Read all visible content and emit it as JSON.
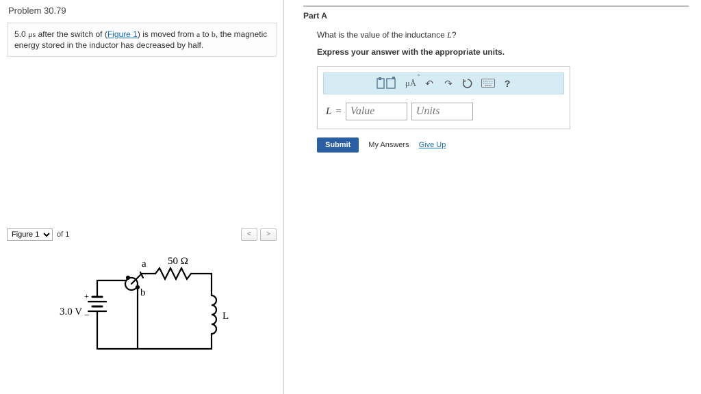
{
  "problem": {
    "title": "Problem 30.79",
    "text_before": "5.0 ",
    "text_mu_s": "μs",
    "text_mid1": " after the switch of (",
    "figure_link": "Figure 1",
    "text_mid2": ") is moved from ",
    "a": "a",
    "text_mid3": " to ",
    "b": "b",
    "text_after": ", the magnetic energy stored in the inductor has decreased by half."
  },
  "figure": {
    "select_label": "Figure 1",
    "of_label": "of 1",
    "prev": "<",
    "next": ">",
    "labels": {
      "voltage": "3.0 V",
      "resistor": "50 Ω",
      "node_a": "a",
      "node_b": "b",
      "inductor": "L",
      "plus": "+",
      "minus": "−"
    }
  },
  "part": {
    "header": "Part A",
    "question_pre": "What is the value of the inductance ",
    "question_var": "L",
    "question_post": "?",
    "instruction": "Express your answer with the appropriate units.",
    "toolbar": {
      "units": "μÅ",
      "help": "?"
    },
    "answer": {
      "lhs": "L",
      "eq": "=",
      "value_placeholder": "Value",
      "units_placeholder": "Units"
    },
    "submit": "Submit",
    "my_answers": "My Answers",
    "give_up": "Give Up"
  }
}
